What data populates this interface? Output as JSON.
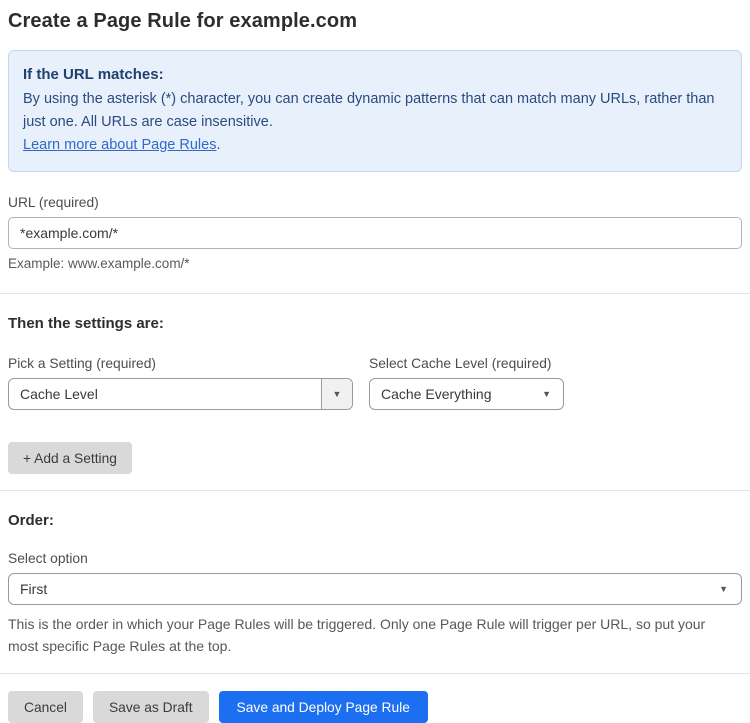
{
  "page": {
    "title": "Create a Page Rule for example.com"
  },
  "info_box": {
    "heading": "If the URL matches:",
    "body": "By using the asterisk (*) character, you can create dynamic patterns that can match many URLs, rather than just one. All URLs are case insensitive.",
    "link_label": "Learn more about Page Rules",
    "link_suffix": "."
  },
  "url_field": {
    "label": "URL (required)",
    "value": "*example.com/*",
    "helper": "Example: www.example.com/*"
  },
  "settings_section": {
    "heading": "Then the settings are:",
    "setting_picker": {
      "label": "Pick a Setting (required)",
      "value": "Cache Level",
      "caret": "▼"
    },
    "cache_level_picker": {
      "label": "Select Cache Level (required)",
      "value": "Cache Everything",
      "caret": "▼"
    },
    "add_setting_label": "+ Add a Setting"
  },
  "order_section": {
    "heading": "Order:",
    "label": "Select option",
    "value": "First",
    "caret": "▼",
    "helper": "This is the order in which your Page Rules will be triggered. Only one Page Rule will trigger per URL, so put your most specific Page Rules at the top."
  },
  "footer": {
    "cancel_label": "Cancel",
    "save_draft_label": "Save as Draft",
    "save_deploy_label": "Save and Deploy Page Rule"
  },
  "colors": {
    "accent_blue": "#1d6ff2",
    "info_background": "#e8f1fb",
    "info_border": "#bed8f3",
    "info_text": "#2a4a80",
    "link_blue": "#3268c7",
    "button_gray": "#d9d9d9"
  }
}
